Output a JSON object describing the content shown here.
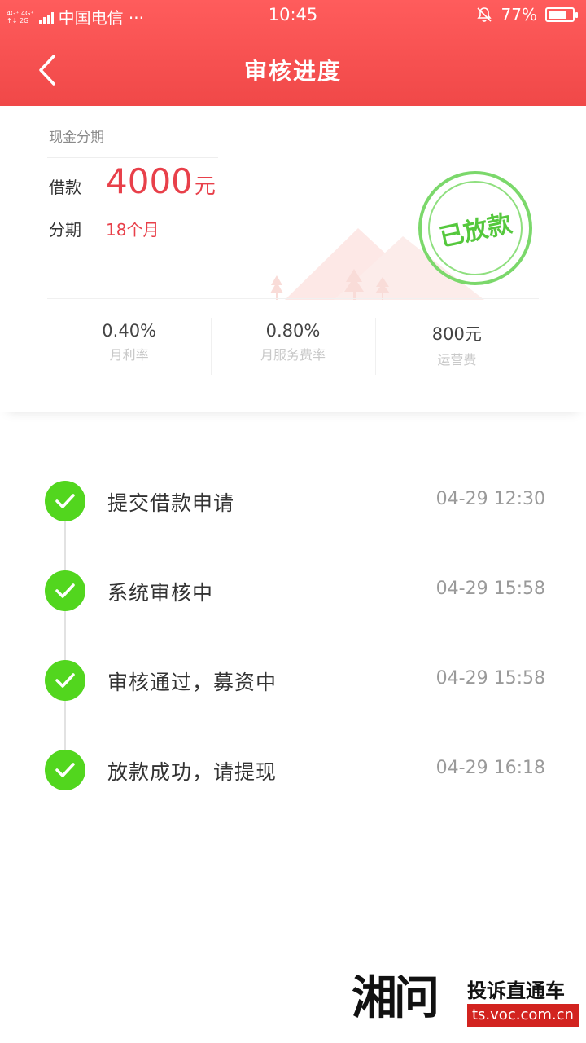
{
  "status_bar": {
    "net_badges": [
      "4G⁺ 4G⁺",
      "↑↓ 2G"
    ],
    "carrier": "中国电信 ···",
    "time": "10:45",
    "battery": "77%",
    "battery_level": 0.77
  },
  "nav": {
    "title": "审核进度",
    "back_icon": "chevron-left-icon"
  },
  "summary": {
    "product_type": "现金分期",
    "loan_label": "借款",
    "loan_amount": "4000",
    "loan_unit": "元",
    "term_label": "分期",
    "term_value": "18个月",
    "stamp_text": "已放款",
    "rates": [
      {
        "value": "0.40%",
        "label": "月利率"
      },
      {
        "value": "0.80%",
        "label": "月服务费率"
      },
      {
        "value": "800元",
        "label": "运营费"
      }
    ]
  },
  "timeline": {
    "steps": [
      {
        "label": "提交借款申请",
        "time": "04-29 12:30"
      },
      {
        "label": "系统审核中",
        "time": "04-29 15:58"
      },
      {
        "label": "审核通过，募资中",
        "time": "04-29 15:58"
      },
      {
        "label": "放款成功，请提现",
        "time": "04-29 16:18"
      }
    ]
  },
  "watermark": {
    "brand": "湘问",
    "slogan": "投诉直通车",
    "domain": "ts.voc.com.cn"
  },
  "colors": {
    "header_red": "#f04848",
    "amount_red": "#e8404a",
    "check_green": "#52d61e",
    "stamp_green": "#55c83d"
  }
}
